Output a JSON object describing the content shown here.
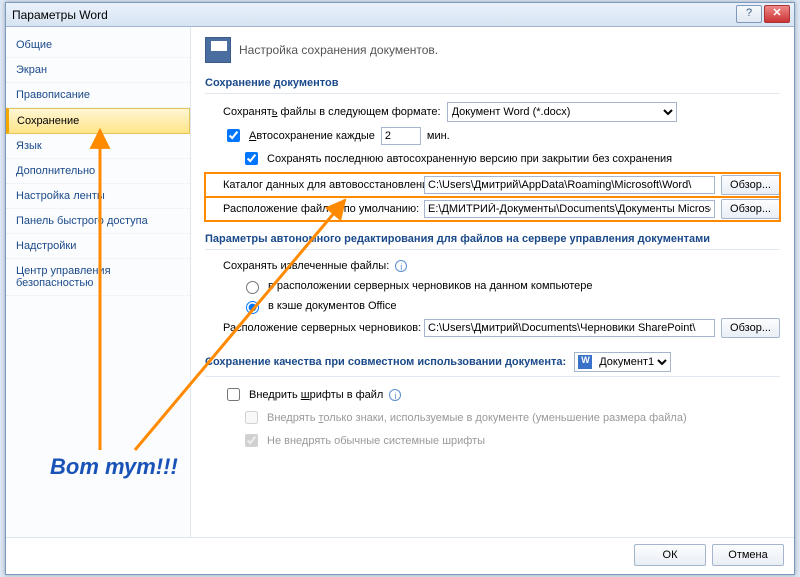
{
  "title": "Параметры Word",
  "win": {
    "help": "?",
    "close": "✕"
  },
  "sidebar": {
    "items": [
      {
        "label": "Общие"
      },
      {
        "label": "Экран"
      },
      {
        "label": "Правописание"
      },
      {
        "label": "Сохранение",
        "selected": true
      },
      {
        "label": "Язык"
      },
      {
        "label": "Дополнительно"
      },
      {
        "label": "Настройка ленты"
      },
      {
        "label": "Панель быстрого доступа"
      },
      {
        "label": "Надстройки"
      },
      {
        "label": "Центр управления безопасностью"
      }
    ]
  },
  "header": {
    "text": "Настройка сохранения документов."
  },
  "sections": {
    "save_docs": "Сохранение документов",
    "autoedit": "Параметры автономного редактирования для файлов на сервере управления документами",
    "quality": "Сохранение качества при совместном использовании документа:"
  },
  "save": {
    "format_label": "Сохранять файлы в следующем формате:",
    "format_value": "Документ Word (*.docx)",
    "autosave_label": "Автосохранение каждые",
    "autosave_value": "2",
    "minutes_label": "мин.",
    "keep_last_label": "Сохранять последнюю автосохраненную версию при закрытии без сохранения",
    "autorecover_label": "Каталог данных для автовосстановления:",
    "autorecover_path": "C:\\Users\\Дмитрий\\AppData\\Roaming\\Microsoft\\Word\\",
    "default_loc_label": "Расположение файлов по умолчанию:",
    "default_loc_path": "E:\\ДМИТРИЙ-Документы\\Documents\\Документы Microsoft Word",
    "browse": "Обзор..."
  },
  "offline": {
    "save_checked_label": "Сохранять извлеченные файлы:",
    "opt_local": "в расположении серверных черновиков на данном компьютере",
    "opt_cache": "в кэше документов Office",
    "drafts_loc_label": "Расположение серверных черновиков:",
    "drafts_path": "C:\\Users\\Дмитрий\\Documents\\Черновики SharePoint\\"
  },
  "quality": {
    "doc_name": "Документ1",
    "embed_fonts": "Внедрить шрифты в файл",
    "embed_only_used": "Внедрять только знаки, используемые в документе (уменьшение размера файла)",
    "no_system_fonts": "Не внедрять обычные системные шрифты"
  },
  "footer": {
    "ok": "ОК",
    "cancel": "Отмена"
  },
  "callout": "Вот тут!!!"
}
